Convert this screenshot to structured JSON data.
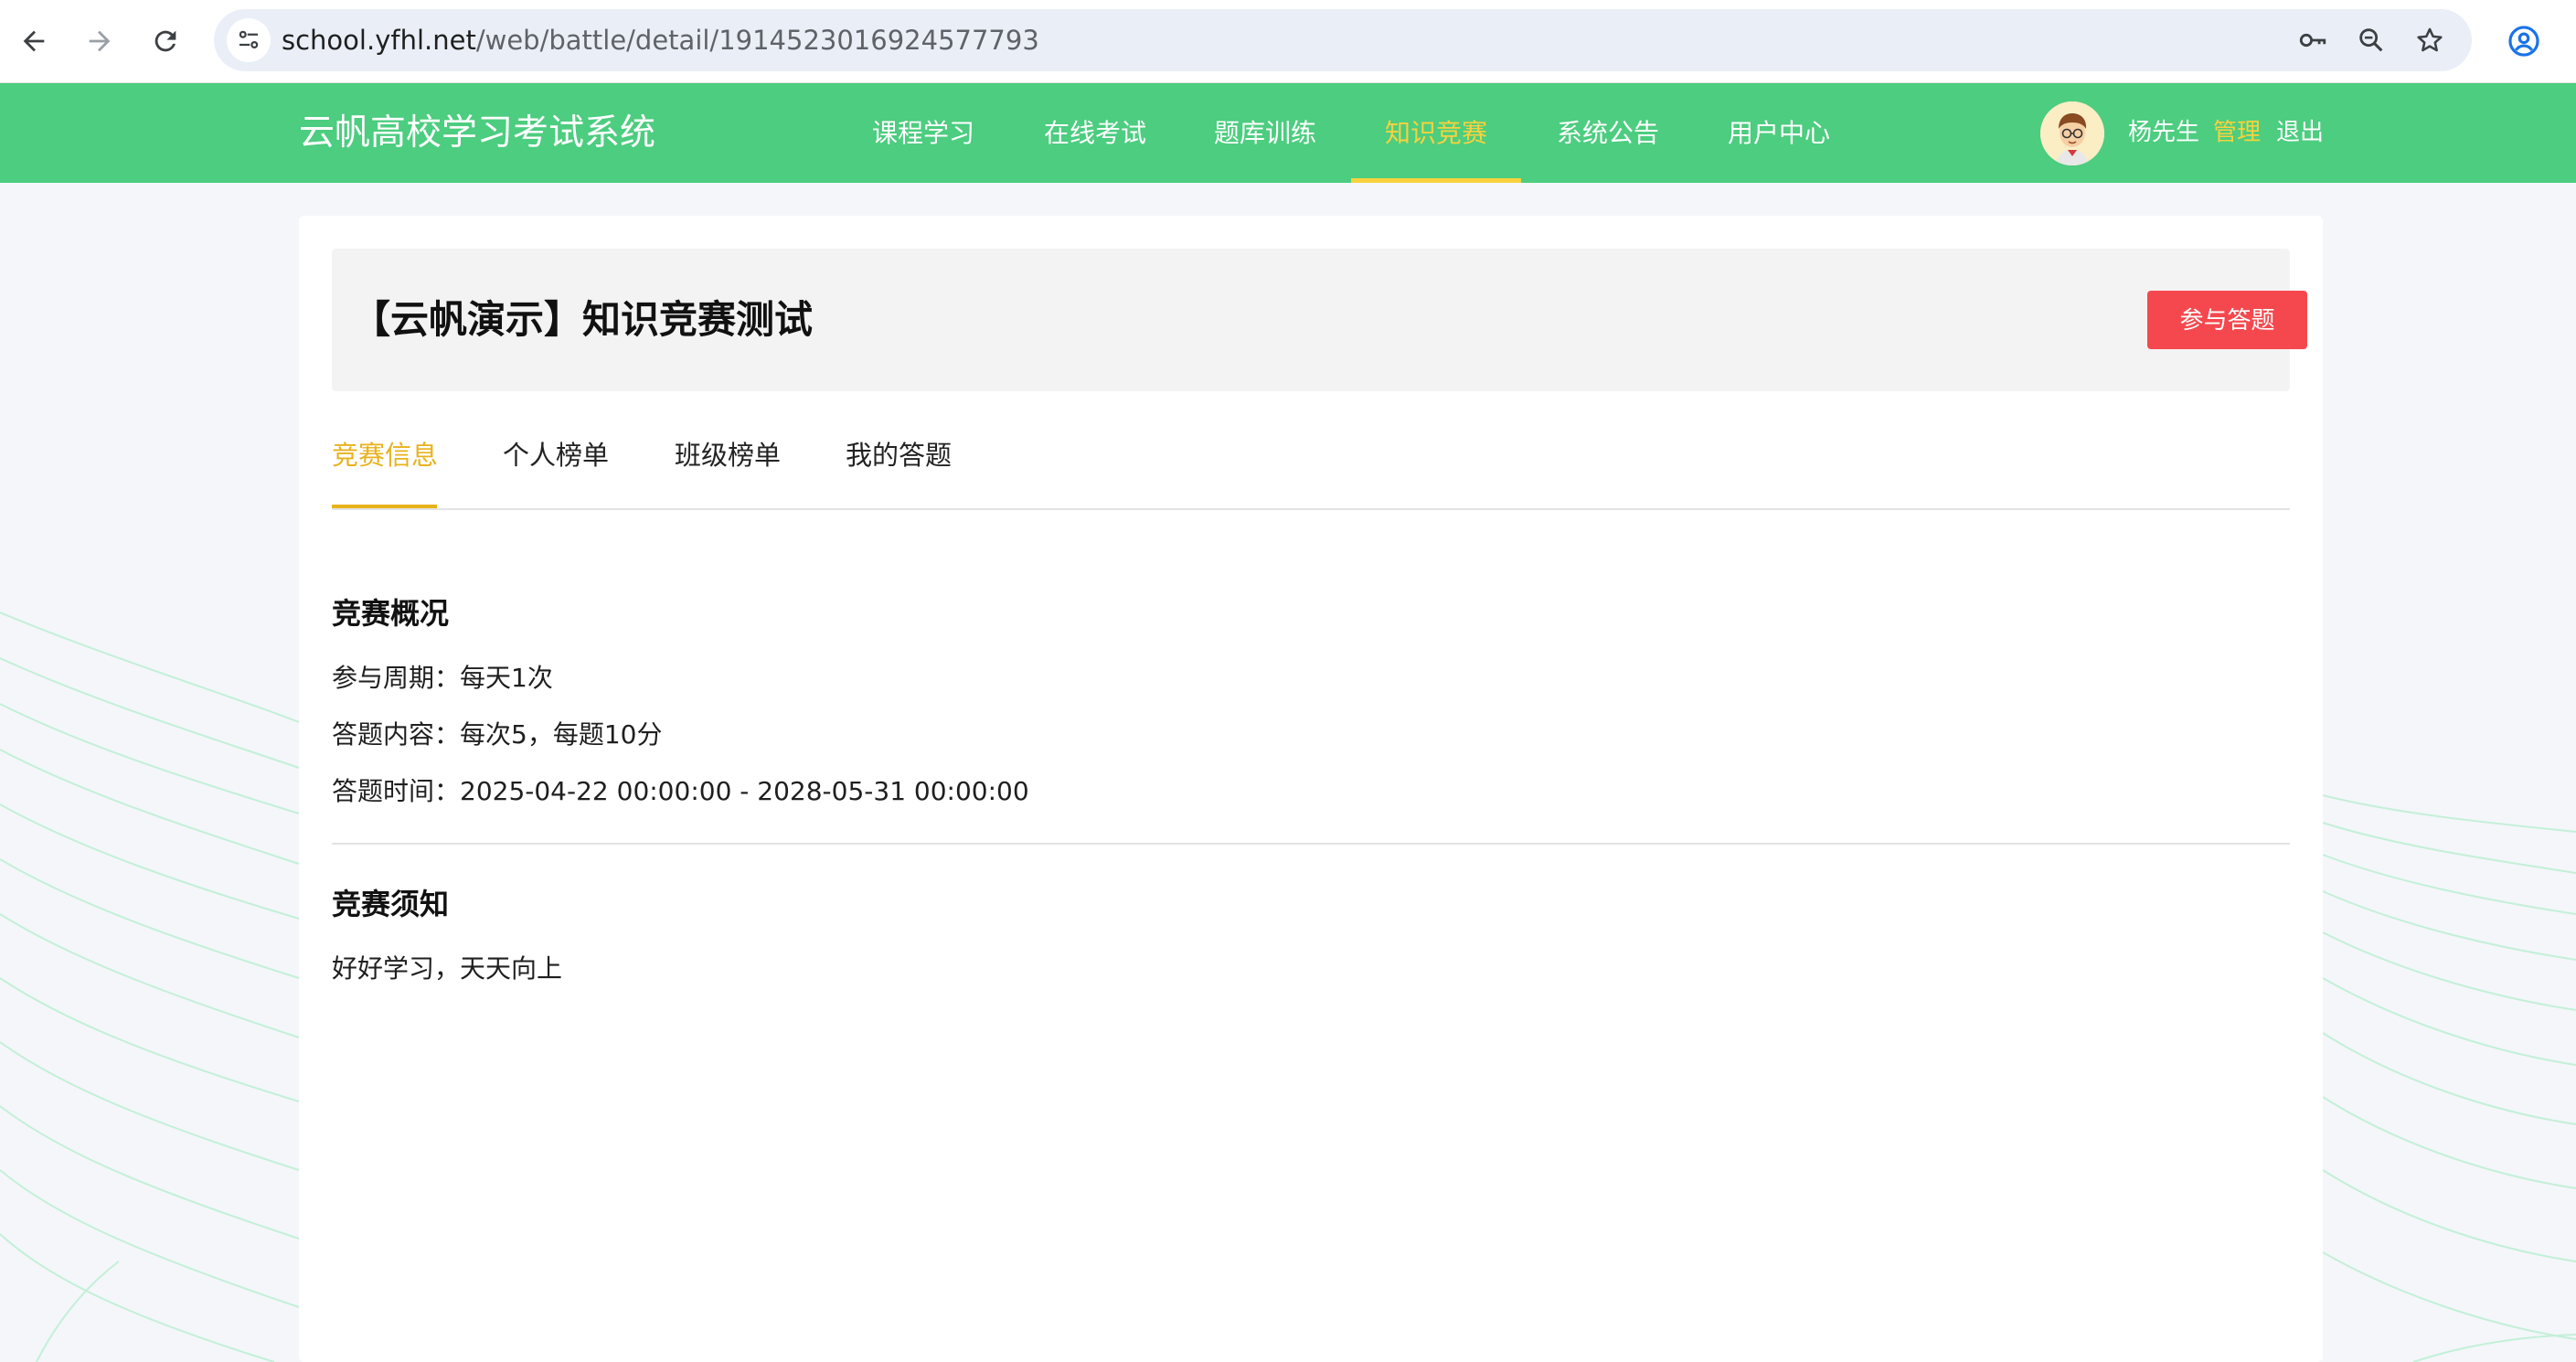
{
  "browser": {
    "url_host": "school.yfhl.net",
    "url_path": "/web/battle/detail/1914523016924577793"
  },
  "header": {
    "site_title": "云帆高校学习考试系统",
    "nav": [
      {
        "label": "课程学习",
        "active": false
      },
      {
        "label": "在线考试",
        "active": false
      },
      {
        "label": "题库训练",
        "active": false
      },
      {
        "label": "知识竞赛",
        "active": true
      },
      {
        "label": "系统公告",
        "active": false
      },
      {
        "label": "用户中心",
        "active": false
      }
    ],
    "user_name": "杨先生",
    "admin_label": "管理",
    "logout_label": "退出"
  },
  "battle": {
    "title": "【云帆演示】知识竞赛测试",
    "join_label": "参与答题"
  },
  "tabs": [
    {
      "label": "竞赛信息",
      "active": true
    },
    {
      "label": "个人榜单",
      "active": false
    },
    {
      "label": "班级榜单",
      "active": false
    },
    {
      "label": "我的答题",
      "active": false
    }
  ],
  "overview": {
    "heading": "竞赛概况",
    "cycle": "参与周期：每天1次",
    "content": "答题内容：每次5，每题10分",
    "time": "答题时间：2025-04-22 00:00:00 - 2028-05-31 00:00:00"
  },
  "notice": {
    "heading": "竞赛须知",
    "text": "好好学习，天天向上"
  },
  "colors": {
    "header_green": "#4ccd7f",
    "active_nav": "#f7d23e",
    "active_tab": "#e8b21c",
    "join_button": "#f5484e"
  }
}
